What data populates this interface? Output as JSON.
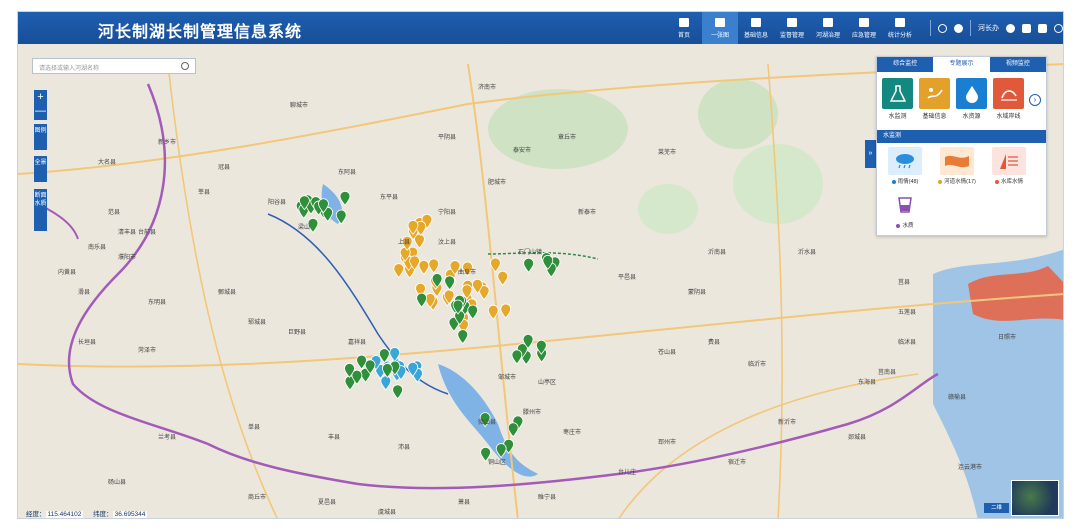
{
  "header": {
    "title": "河长制湖长制管理信息系统",
    "nav": [
      {
        "label": "首页",
        "icon": "home-icon"
      },
      {
        "label": "一张图",
        "icon": "map-icon",
        "active": true
      },
      {
        "label": "基础信息",
        "icon": "document-icon"
      },
      {
        "label": "监督管理",
        "icon": "shield-icon"
      },
      {
        "label": "河湖治理",
        "icon": "factory-icon"
      },
      {
        "label": "应急管理",
        "icon": "alarm-icon"
      },
      {
        "label": "统计分析",
        "icon": "bar-chart-icon"
      }
    ],
    "user": "河长办"
  },
  "search": {
    "placeholder": "请选择或输入河湖名称"
  },
  "map_tools": {
    "zoom_in": "+",
    "zoom_out": "—",
    "legend": "图例",
    "full_view": "全景",
    "section": "断面水质"
  },
  "panel": {
    "tabs": [
      {
        "label": "综合监控"
      },
      {
        "label": "专题展示",
        "active": true
      },
      {
        "label": "视频监控"
      }
    ],
    "categories": [
      {
        "label": "水监测",
        "icon": "flask-icon",
        "color": "#13887f"
      },
      {
        "label": "基础信息",
        "icon": "info-icon",
        "color": "#e3a12c"
      },
      {
        "label": "水资源",
        "icon": "water-drop-icon",
        "color": "#1b7fd1"
      },
      {
        "label": "水域岸线",
        "icon": "shoreline-icon",
        "color": "#e1593b"
      }
    ],
    "section_title": "水监测",
    "subcategories": [
      {
        "label": "雨情(48)",
        "icon": "rain-cloud-icon",
        "dot": "#1b7fd1"
      },
      {
        "label": "河道水情(17)",
        "icon": "river-icon",
        "dot": "#e3a12c"
      },
      {
        "label": "水库水情",
        "icon": "reservoir-icon",
        "dot": "#e1593b"
      },
      {
        "label": "水质",
        "icon": "water-quality-icon",
        "dot": "#8a4fb3"
      }
    ]
  },
  "status": {
    "lon_label": "经度：",
    "lon_value": "115.464102",
    "lat_label": "纬度：",
    "lat_value": "36.695344"
  },
  "layer_switch": "二维",
  "map": {
    "places": [
      "济南市",
      "泰安市",
      "聊城市",
      "东平县",
      "梁山",
      "上县",
      "濮阳市",
      "石门山镇",
      "平邑县",
      "费县",
      "临沂市",
      "郯城县",
      "菏泽市",
      "曲阜市",
      "邹城市",
      "枣庄市",
      "滕州市",
      "微山县",
      "台儿庄",
      "宿迁市",
      "连云港市",
      "日照市",
      "莒县",
      "沂南县",
      "新泰市",
      "宁阳县",
      "巨野县",
      "单县",
      "兰考县",
      "商丘市",
      "砀山县",
      "丰县",
      "沛县",
      "邳州市",
      "新沂市",
      "东海县",
      "苍山县",
      "山亭区",
      "嘉祥县",
      "汶上县",
      "鄄城县",
      "郓城县",
      "阳谷县",
      "东阿县",
      "平阴县",
      "肥城市",
      "章丘市",
      "莱芜市",
      "蒙阴县",
      "沂水县",
      "五莲县",
      "莒南县",
      "临沭县",
      "赣榆县",
      "睢宁县",
      "铜山区",
      "萧县",
      "夏邑县",
      "虞城县",
      "东明县",
      "长垣县",
      "台前县",
      "范县",
      "莘县",
      "冠县",
      "新乡市",
      "滑县",
      "内黄县",
      "南乐县",
      "清丰县",
      "大名县"
    ]
  }
}
